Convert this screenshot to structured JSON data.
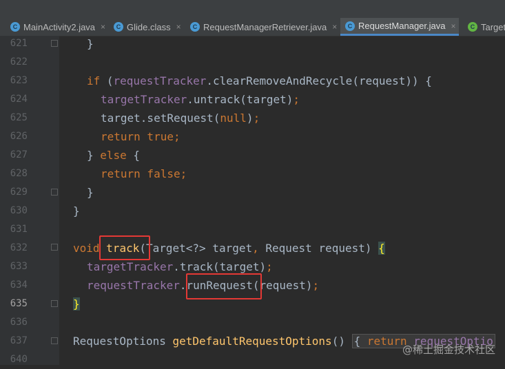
{
  "tabs": [
    {
      "icon": "C",
      "name": "MainActivity2.java",
      "active": false
    },
    {
      "icon": "C",
      "name": "Glide.class",
      "active": false
    },
    {
      "icon": "C",
      "name": "RequestManagerRetriever.java",
      "active": false
    },
    {
      "icon": "C",
      "name": "RequestManager.java",
      "active": true
    },
    {
      "icon": "C",
      "name": "Target",
      "active": false
    }
  ],
  "close_glyph": "×",
  "line_numbers": [
    "621",
    "622",
    "623",
    "624",
    "625",
    "626",
    "627",
    "628",
    "629",
    "630",
    "631",
    "632",
    "633",
    "634",
    "635",
    "636",
    "637",
    "640"
  ],
  "code": {
    "l621": "}",
    "l623_kw": "if",
    "l623_a": " (",
    "l623_fld": "requestTracker",
    "l623_b": ".clearRemoveAndRecycle(request)) {",
    "l624_fld": "targetTracker",
    "l624_b": ".untrack(target)",
    "l624_c": ";",
    "l625_a": "target.setRequest(",
    "l625_kw": "null",
    "l625_b": ")",
    "l625_c": ";",
    "l626_kw": "return true",
    "l626_c": ";",
    "l627_a": "} ",
    "l627_kw": "else",
    "l627_b": " {",
    "l628_kw": "return false",
    "l628_c": ";",
    "l629": "}",
    "l630": "}",
    "l632_kw": "void",
    "l632_sp": " ",
    "l632_meth": "track",
    "l632_b": "(Target<?> target",
    "l632_c": ",",
    "l632_d": " Request request) ",
    "l632_brace": "{",
    "l633_fld": "targetTracker",
    "l633_b": ".track(target)",
    "l633_c": ";",
    "l634_fld": "requestTracker",
    "l634_dot": ".",
    "l634_m": "runRequest",
    "l634_b": "(request)",
    "l634_c": ";",
    "l635_brace": "}",
    "l637_a": "RequestOptions ",
    "l637_meth": "getDefaultRequestOptions",
    "l637_b": "() ",
    "l637_fold": "{ ",
    "l637_kw": "return",
    "l637_c": " requestOptio"
  },
  "watermark": "@稀土掘金技术社区"
}
